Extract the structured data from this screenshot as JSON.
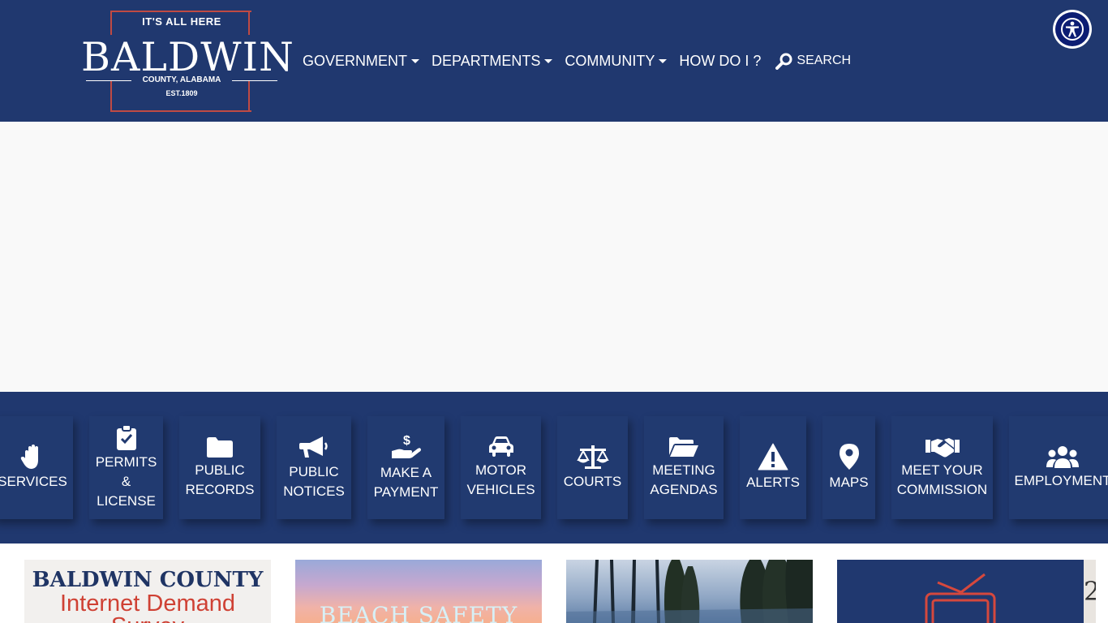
{
  "header": {
    "logo": {
      "tagline": "IT'S ALL HERE",
      "name": "BALDWIN",
      "county": "COUNTY, ALABAMA",
      "est": "EST.1809"
    },
    "nav": [
      {
        "label": "GOVERNMENT",
        "has_dropdown": true
      },
      {
        "label": "DEPARTMENTS",
        "has_dropdown": true
      },
      {
        "label": "COMMUNITY",
        "has_dropdown": true
      },
      {
        "label": "HOW DO I ?",
        "has_dropdown": false
      }
    ],
    "search_label": "SEARCH",
    "accessibility_icon": "accessibility-icon"
  },
  "quick_links": [
    {
      "label": "SERVICES",
      "icon": "hand-icon"
    },
    {
      "label": "PERMITS & LICENSE",
      "icon": "clipboard-check-icon"
    },
    {
      "label": "PUBLIC RECORDS",
      "icon": "folder-icon"
    },
    {
      "label": "PUBLIC NOTICES",
      "icon": "megaphone-icon"
    },
    {
      "label": "MAKE A PAYMENT",
      "icon": "hand-dollar-icon"
    },
    {
      "label": "MOTOR VEHICLES",
      "icon": "car-icon"
    },
    {
      "label": "COURTS",
      "icon": "scales-icon"
    },
    {
      "label": "MEETING AGENDAS",
      "icon": "folder-open-icon"
    },
    {
      "label": "ALERTS",
      "icon": "warning-icon"
    },
    {
      "label": "MAPS",
      "icon": "map-marker-icon"
    },
    {
      "label": "MEET YOUR COMMISSION",
      "icon": "handshake-icon"
    },
    {
      "label": "EMPLOYMENT",
      "icon": "users-icon"
    }
  ],
  "news_cards": [
    {
      "line1": "BALDWIN COUNTY",
      "line2": "Internet Demand",
      "line3": "Survey"
    },
    {
      "title": "BEACH SAFETY"
    },
    {
      "image": "forest-lake-photo"
    },
    {
      "icon": "tv-icon"
    },
    {
      "partial_text": "2"
    }
  ],
  "colors": {
    "header_bg": "#20386f",
    "logo_border": "#c04a43",
    "hero_bg": "#f9f9f9",
    "tile_bg": "#213a70",
    "accent_red": "#cf4134"
  }
}
